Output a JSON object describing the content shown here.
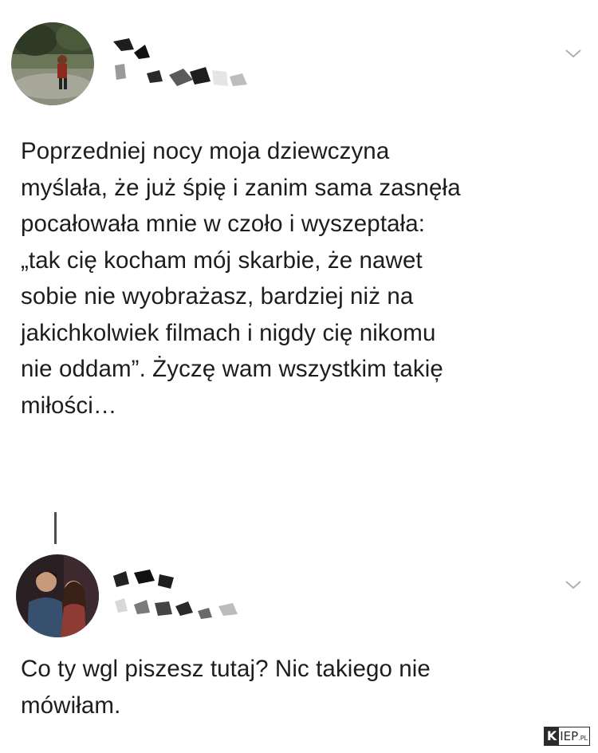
{
  "post": {
    "avatar_icon": "user-avatar-photo",
    "menu_icon": "chevron-down-icon",
    "text": "Poprzedniej nocy moja dziewczyna myślała, że już śpię i zanim sama zasnęła pocałowała mnie w czoło i wyszeptała: „tak cię kocham mój skarbie, że nawet sobie nie wyobrażasz, bardziej niż na jakichkolwiek filmach i nigdy cię nikomu nie oddam”. Życzę wam wszystkim takie̦ miłości…",
    "lines": [
      "Poprzedniej nocy moja dziewczyna",
      "myślała, że już śpię i zanim sama zasnęła",
      "pocałowała mnie w czoło i wyszeptała:",
      "„tak cię kocham mój skarbie, że nawet",
      "sobie nie wyobrażasz, bardziej niż na",
      "jakichkolwiek filmach i nigdy cię nikomu",
      "nie oddam”. Życzę wam wszystkim takie̦",
      "miłości…"
    ]
  },
  "reply": {
    "avatar_icon": "user-avatar-photo",
    "menu_icon": "chevron-down-icon",
    "lines": [
      "Co ty wgl piszesz tutaj? Nic takiego nie",
      "mówiłam."
    ]
  },
  "watermark": {
    "k": "K",
    "rest": "IEP",
    "suffix": ".PL"
  },
  "colors": {
    "text": "#1d1d1d",
    "chevron": "#aab2bb",
    "thread_line": "#4d4d4d"
  }
}
